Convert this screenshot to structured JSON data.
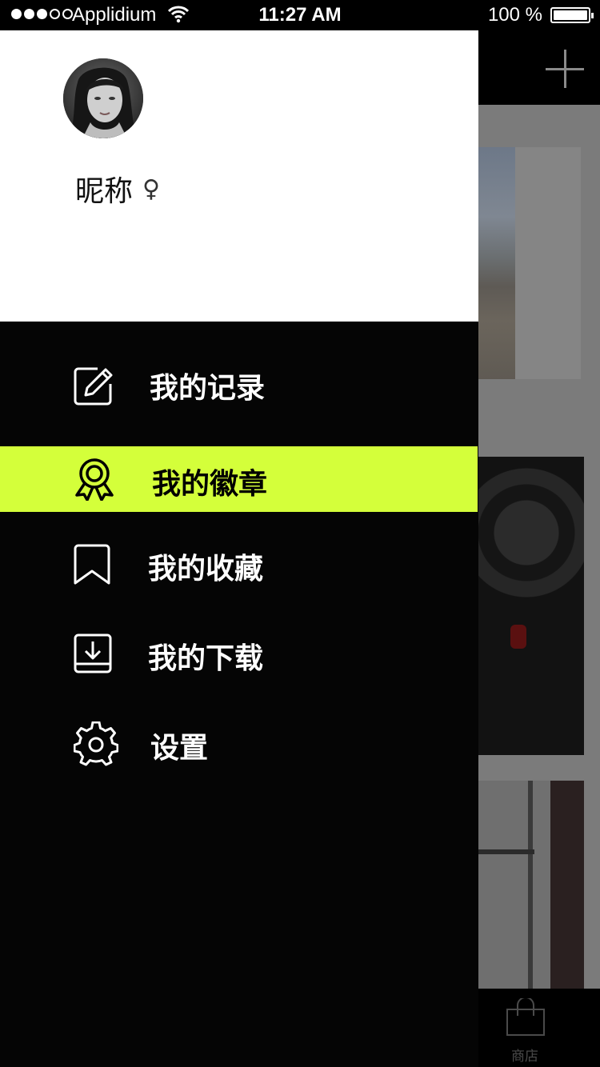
{
  "status_bar": {
    "signal_full": 3,
    "signal_total": 5,
    "carrier": "Applidium",
    "time": "11:27 AM",
    "battery": "100 %",
    "battery_level": 1.0
  },
  "profile": {
    "nickname": "昵称",
    "gender_symbol": "♀"
  },
  "menu": {
    "items": [
      {
        "label": "我的记录",
        "icon": "edit-icon",
        "active": false
      },
      {
        "label": "我的徽章",
        "icon": "badge-icon",
        "active": true
      },
      {
        "label": "我的收藏",
        "icon": "bookmark-icon",
        "active": false
      },
      {
        "label": "我的下载",
        "icon": "download-icon",
        "active": false
      },
      {
        "label": "设置",
        "icon": "gear-icon",
        "active": false
      }
    ]
  },
  "background_app": {
    "tab_shop_label": "商店",
    "add_icon": "plus-icon",
    "shop_icon": "shopping-bag-icon"
  },
  "colors": {
    "accent": "#d4ff3a",
    "drawer_bg": "#050505",
    "profile_bg": "#ffffff"
  }
}
